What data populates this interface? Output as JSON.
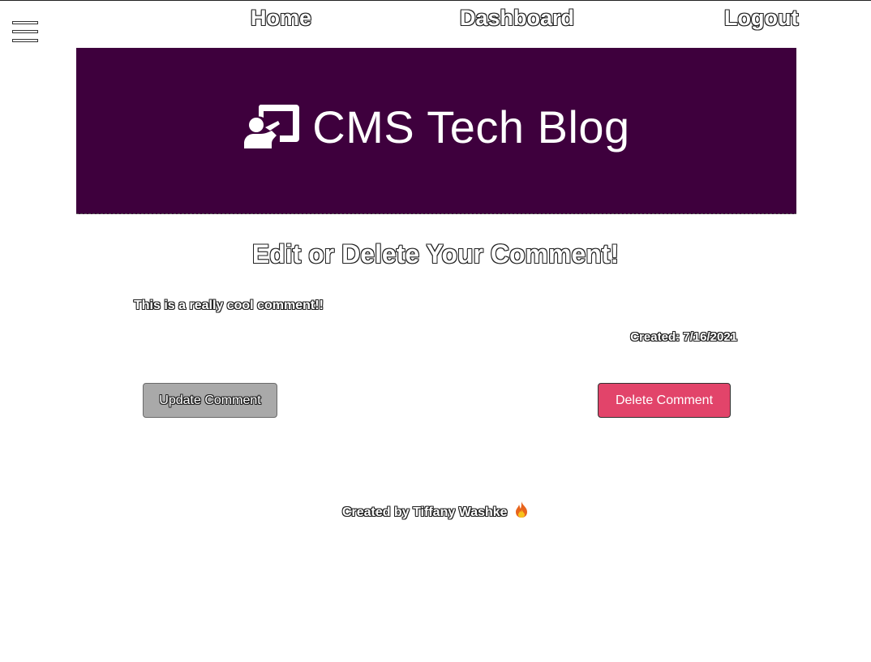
{
  "nav": {
    "home": "Home",
    "dashboard": "Dashboard",
    "logout": "Logout"
  },
  "banner": {
    "title": "CMS Tech Blog",
    "icon": "chalkboard-teacher-icon",
    "background": "#3e003d"
  },
  "page": {
    "heading": "Edit or Delete Your Comment!"
  },
  "comment": {
    "text": "This is a really cool comment!!",
    "created": "Created: 7/16/2021"
  },
  "buttons": {
    "update": "Update Comment",
    "delete": "Delete Comment",
    "delete_color": "#e2446a",
    "update_color": "#a9a9a9"
  },
  "footer": {
    "text": "Created by Tiffany Washke",
    "icon": "fire-icon"
  }
}
